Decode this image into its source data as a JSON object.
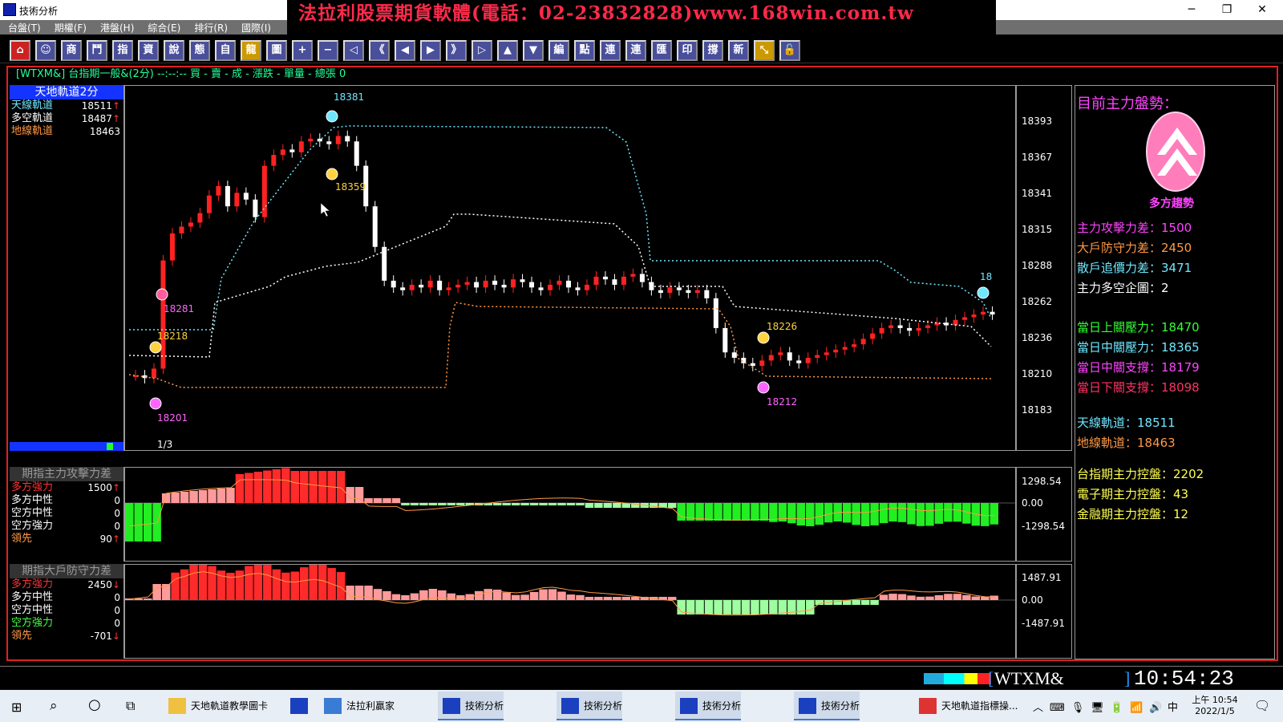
{
  "window": {
    "title": "技術分析",
    "banner": "法拉利股票期貨軟體(電話：02-23832828)www.168win.com.tw"
  },
  "menus": [
    "台盤(T)",
    "期權(F)",
    "港盤(H)",
    "綜合(E)",
    "排行(R)",
    "國際(I)"
  ],
  "toolbar": [
    "⌂",
    "☺",
    "商",
    "鬥",
    "指",
    "資",
    "說",
    "態",
    "自",
    "龍",
    "圖",
    "+",
    "−",
    "◁",
    "《",
    "◀",
    "▶",
    "》",
    "▷",
    "▲",
    "▼",
    "編",
    "點",
    "連",
    "連",
    "匯",
    "印",
    "撐",
    "新",
    "⤡",
    "🔓"
  ],
  "infobar": "[WTXM&] 台指期一般&(2分)  --:--:-- 買 - 賣 - 成 - 漲跌 - 單量 - 總張 0",
  "main_left": {
    "title": "天地軌道2分",
    "rows": [
      {
        "label": "天線軌道",
        "value": "18511",
        "arrow": "↑",
        "color": "#6ee7ff"
      },
      {
        "label": "多空軌道",
        "value": "18487",
        "arrow": "↑",
        "color": "#ffffff"
      },
      {
        "label": "地線軌道",
        "value": "18463",
        "arrow": "",
        "color": "#ff9944"
      }
    ],
    "page": "1/3"
  },
  "main_scale": [
    "18393",
    "18367",
    "18341",
    "18315",
    "18288",
    "18262",
    "18236",
    "18210",
    "18183"
  ],
  "annotations": [
    "18381",
    "18359",
    "18281",
    "18218",
    "18201",
    "18226",
    "18212",
    "18"
  ],
  "sub1": {
    "title": "期指主力攻擊力差",
    "rows": [
      {
        "label": "多方強力",
        "value": "1500",
        "arrow": "↑",
        "color": "#ff3333"
      },
      {
        "label": "多方中性",
        "value": "0",
        "arrow": "",
        "color": "#ffffff"
      },
      {
        "label": "空方中性",
        "value": "0",
        "arrow": "",
        "color": "#ffffff"
      },
      {
        "label": "空方強力",
        "value": "0",
        "arrow": "",
        "color": "#ffffff"
      },
      {
        "label": "領先",
        "value": "90",
        "arrow": "↑",
        "color": "#ff9944"
      }
    ],
    "scale": [
      "1298.54",
      "0.00",
      "-1298.54"
    ]
  },
  "sub2": {
    "title": "期指大戶防守力差",
    "rows": [
      {
        "label": "多方強力",
        "value": "2450",
        "arrow": "↓",
        "color": "#ff3333"
      },
      {
        "label": "多方中性",
        "value": "0",
        "arrow": "",
        "color": "#ffffff"
      },
      {
        "label": "空方中性",
        "value": "0",
        "arrow": "",
        "color": "#ffffff"
      },
      {
        "label": "空方強力",
        "value": "0",
        "arrow": "",
        "color": "#44ff44"
      },
      {
        "label": "領先",
        "value": "-701",
        "arrow": "↓",
        "color": "#ff9944"
      }
    ],
    "scale": [
      "1487.91",
      "0.00",
      "-1487.91"
    ]
  },
  "right": {
    "heading": "目前主力盤勢：",
    "badge": "多方趨勢",
    "items": [
      {
        "label": "主力攻擊力差：1500",
        "color": "#ff44ff"
      },
      {
        "label": "大戶防守力差：2450",
        "color": "#ff9944"
      },
      {
        "label": "散戶追價力差：3471",
        "color": "#6ee7ff"
      },
      {
        "label": "主力多空企圖：2",
        "color": "#ffffff"
      },
      {
        "label": "當日上關壓力：18470",
        "color": "#33ff33"
      },
      {
        "label": "當日中關壓力：18365",
        "color": "#6ee7ff"
      },
      {
        "label": "當日中關支撐：18179",
        "color": "#ff44ff"
      },
      {
        "label": "當日下關支撐：18098",
        "color": "#ff3366"
      },
      {
        "label": "天線軌道：18511",
        "color": "#6ee7ff"
      },
      {
        "label": "地線軌道：18463",
        "color": "#ff9944"
      },
      {
        "label": "台指期主力控盤：2202",
        "color": "#ffff55"
      },
      {
        "label": "電子期主力控盤：43",
        "color": "#ffff55"
      },
      {
        "label": "金融期主力控盤：12",
        "color": "#ffff55"
      }
    ]
  },
  "status": {
    "symbol": "WTXM&",
    "time": "10:54:23"
  },
  "taskbar": {
    "items": [
      "天地軌道教學圖卡",
      "",
      "法拉利贏家",
      "技術分析",
      "技術分析",
      "技術分析",
      "技術分析",
      "天地軌道指標操..."
    ],
    "clock_time": "上午 10:54",
    "clock_date": "2022/1/5",
    "ime": "中"
  }
}
